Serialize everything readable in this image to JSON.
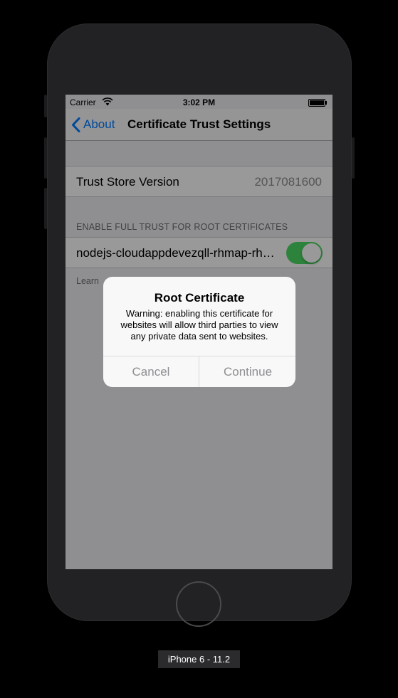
{
  "device": {
    "label": "iPhone 6 - 11.2"
  },
  "status_bar": {
    "carrier": "Carrier",
    "time": "3:02 PM",
    "wifi_icon": "wifi-icon",
    "battery_icon": "battery-icon",
    "battery_level": 1.0
  },
  "nav_bar": {
    "back_label": "About",
    "title": "Certificate Trust Settings"
  },
  "trust_store": {
    "label": "Trust Store Version",
    "value": "2017081600"
  },
  "root_certs": {
    "section_header": "ENABLE FULL TRUST FOR ROOT CERTIFICATES",
    "certificate_name": "nodejs-cloudappdevezqll-rhmap-rhmap-root",
    "toggle_on": true,
    "footer": "Learn"
  },
  "alert": {
    "title": "Root Certificate",
    "message": "Warning: enabling this certificate for websites will allow third parties to view any private data sent to websites.",
    "cancel_label": "Cancel",
    "continue_label": "Continue"
  },
  "colors": {
    "accent": "#007aff",
    "toggle_on": "#4cd964",
    "background": "#efeff4"
  }
}
